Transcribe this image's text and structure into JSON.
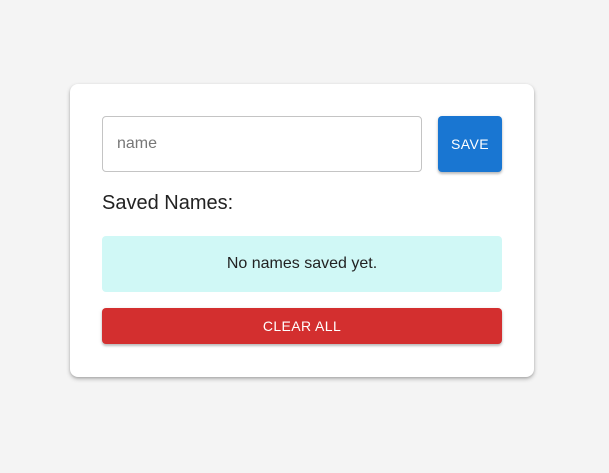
{
  "form": {
    "name_value": "",
    "name_placeholder": "name",
    "save_label": "SAVE"
  },
  "saved": {
    "heading": "Saved Names:",
    "empty_message": "No names saved yet."
  },
  "actions": {
    "clear_label": "CLEAR ALL"
  },
  "colors": {
    "page_background": "#f4f4f4",
    "save_button": "#1976d2",
    "empty_box": "#d0f8f6",
    "clear_button": "#d32f2f"
  }
}
